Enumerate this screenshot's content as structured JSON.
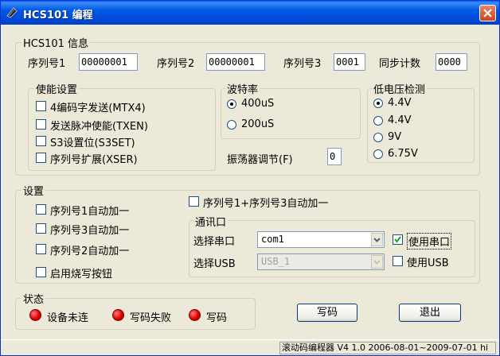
{
  "window": {
    "title": "HCS101 编程"
  },
  "hcs_info": {
    "legend": "HCS101 信息",
    "serial1_label": "序列号1",
    "serial1_value": "00000001",
    "serial2_label": "序列号2",
    "serial2_value": "00000001",
    "serial3_label": "序列号3",
    "serial3_value": "0001",
    "sync_label": "同步计数",
    "sync_value": "0000"
  },
  "enable": {
    "legend": "使能设置",
    "items": [
      "4编码字发送(MTX4)",
      "发送脉冲使能(TXEN)",
      "S3设置位(S3SET)",
      "序列号扩展(XSER)"
    ]
  },
  "baud": {
    "legend": "波特率",
    "options": [
      "400uS",
      "200uS"
    ],
    "selected": 0
  },
  "osc": {
    "label": "振荡器调节(F)",
    "value": "0"
  },
  "lowvolt": {
    "legend": "低电压检测",
    "options": [
      "4.4V",
      "4.4V",
      "9V",
      "6.75V"
    ],
    "selected": 0
  },
  "settings": {
    "legend": "设置",
    "items": [
      "序列号1自动加一",
      "序列号3自动加一",
      "序列号2自动加一",
      "启用烧写按钮"
    ],
    "combo13": "序列号1+序列号3自动加一"
  },
  "comm": {
    "legend": "通讯口",
    "port_label": "选择串口",
    "port_value": "com1",
    "use_serial": "使用串口",
    "use_serial_checked": true,
    "usb_label": "选择USB",
    "usb_value": "USB_1",
    "use_usb": "使用USB",
    "use_usb_checked": false
  },
  "status": {
    "legend": "状态",
    "items": [
      "设备未连",
      "写码失败",
      "写码"
    ],
    "led_color": "#e00000"
  },
  "buttons": {
    "write": "写码",
    "exit": "退出"
  },
  "statusbar": {
    "text": "滚动码编程器 V4 1.0 2006-08-01~2009-07-01 hi"
  }
}
